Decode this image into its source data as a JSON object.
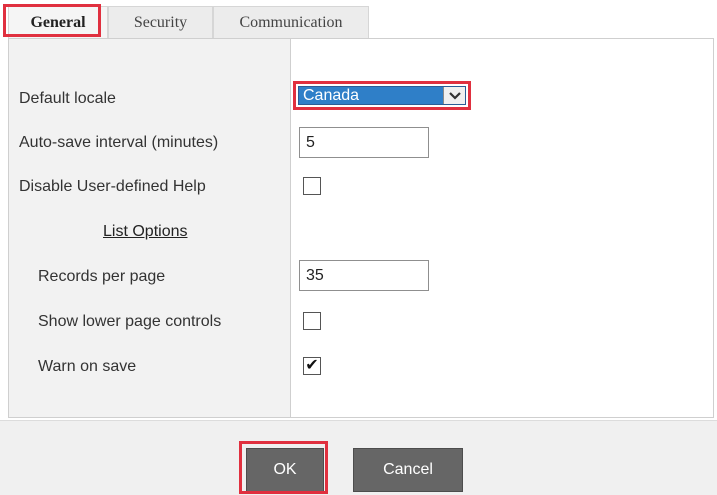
{
  "tabs": [
    {
      "label": "General",
      "active": true
    },
    {
      "label": "Security",
      "active": false
    },
    {
      "label": "Communication",
      "active": false
    }
  ],
  "settings": {
    "default_locale": {
      "label": "Default locale",
      "value": "Canada"
    },
    "autosave": {
      "label": "Auto-save interval (minutes)",
      "value": "5"
    },
    "disable_help": {
      "label": "Disable User-defined Help",
      "checked": false
    },
    "list_options_title": "List Options",
    "records_per_page": {
      "label": "Records per page",
      "value": "35"
    },
    "show_lower_controls": {
      "label": "Show lower page controls",
      "checked": false
    },
    "warn_on_save": {
      "label": "Warn on save",
      "checked": true,
      "check_glyph": "✔"
    }
  },
  "buttons": {
    "ok": "OK",
    "cancel": "Cancel"
  },
  "colors": {
    "highlight": "#e0303f",
    "select_bg": "#2f7fc8",
    "button_bg": "#666666"
  }
}
